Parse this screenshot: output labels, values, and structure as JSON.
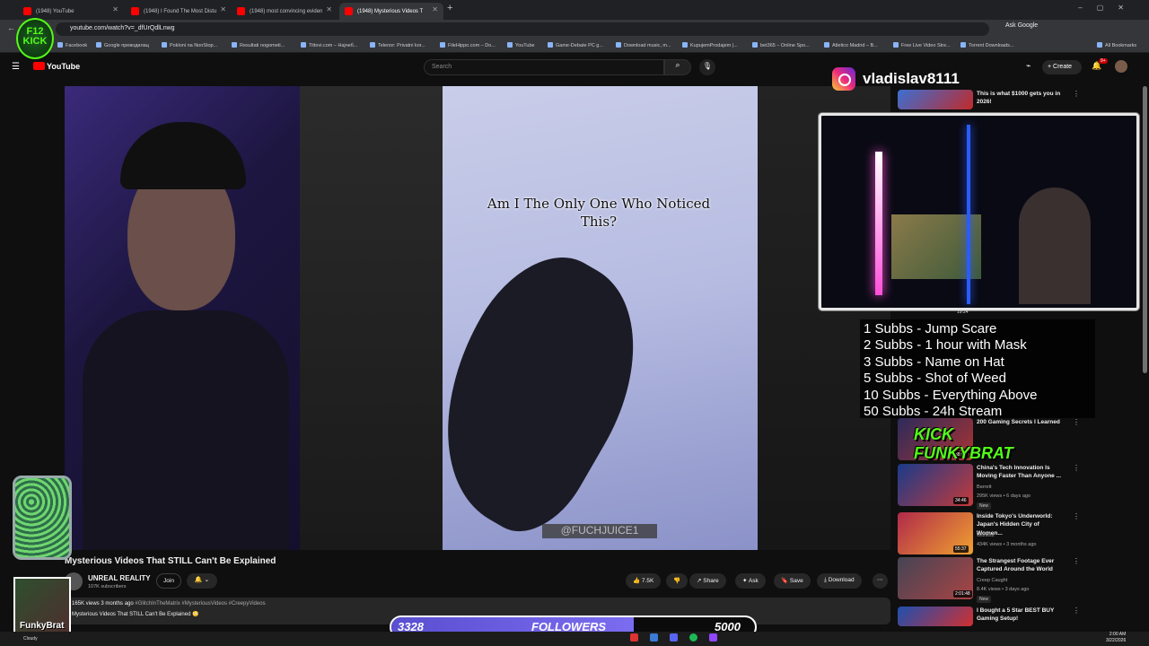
{
  "browser": {
    "tabs": [
      {
        "label": "(1948) YouTube",
        "active": false
      },
      {
        "label": "(1948) I Found The Most Distu",
        "active": false
      },
      {
        "label": "(1948) most convincing eviden",
        "active": false
      },
      {
        "label": "(1948) Mysterious Videos T",
        "active": true
      }
    ],
    "url": "youtube.com/watch?v=_dfUrQdlLnwg",
    "ask_google": "Ask Google",
    "bookmarks": [
      "Facebook",
      "Google преводилац",
      "Pokloni na NonStop...",
      "Resultati nogometi...",
      "Tittovi.com – Најчеб...",
      "Telenor: Privatni kor...",
      "FileHippo.com – Do...",
      "YouTube",
      "Game-Debate PC g...",
      "Download music, m...",
      "KupujemProdajem |...",
      "bet365 – Online Spo...",
      "Atletico Madrid – B...",
      "Free Live Video Stre...",
      "Torrent Downloads..."
    ],
    "all_bookmarks": "All Bookmarks"
  },
  "youtube": {
    "logo": "YouTube",
    "search_placeholder": "Search",
    "create_label": "Create",
    "notifications": "9+"
  },
  "video": {
    "overlay_text": "Am I The Only One Who Noticed This?",
    "watermark": "@FUCHJUICE1",
    "title": "Mysterious Videos That STILL Can't Be Explained",
    "channel": "UNREAL REALITY",
    "subscribers": "107K subscribers",
    "join_label": "Join",
    "likes": "7.5K",
    "share_label": "Share",
    "ask_label": "Ask",
    "save_label": "Save",
    "download_label": "Download",
    "views_line": "165K views  3 months ago",
    "hashtags": "#GlitchInTheMatrix #MysteriousVideos #CreepyVideos",
    "desc_line": "Mysterious Videos That STILL Can't Be Explained 😳"
  },
  "recommendations": [
    {
      "title": "This is what $1000 gets you in 2026!",
      "channel": "",
      "stats": "",
      "duration": "",
      "badge": ""
    },
    {
      "title": "200 Gaming Secrets I Learned",
      "channel": "",
      "stats": "",
      "duration": "38:09",
      "badge": ""
    },
    {
      "title": "China's Tech Innovation Is Moving Faster Than Anyone ...",
      "channel": "Barrett",
      "stats": "295K views • 6 days ago",
      "duration": "34:46",
      "badge": "New"
    },
    {
      "title": "Inside Tokyo's Underworld: Japan's Hidden City of Women...",
      "channel": "Witness",
      "stats": "434K views • 3 months ago",
      "duration": "55:37",
      "badge": ""
    },
    {
      "title": "The Strangest Footage Ever Captured Around the World",
      "channel": "Creep Caught",
      "stats": "8.4K views • 3 days ago",
      "duration": "2:01:48",
      "badge": "New"
    },
    {
      "title": "I Bought a 5 Star BEST BUY Gaming Setup!",
      "channel": "",
      "stats": "",
      "duration": "",
      "badge": ""
    }
  ],
  "stream": {
    "instagram_handle": "vladislav8111",
    "webcam_time": "19:24",
    "sub_goals": [
      "1 Subbs - Jump Scare",
      "2 Subbs - 1 hour with Mask",
      "3 Subbs - Name on Hat",
      "5 Subbs - Shot of Weed",
      "10 Subbs - Everything Above",
      "50 Subbs - 24h Stream"
    ],
    "kick_banner": "KICK FUNKYBRAT",
    "f12_logo": "F12 KICK",
    "avatar_name": "FunkyBrat",
    "followers_current": "3328",
    "followers_label": "FOLLOWERS",
    "followers_goal": "5000",
    "followers_progress": 0.666
  },
  "taskbar": {
    "weather": "Cloudy",
    "time": "2:00 AM",
    "date": "3/22/2026"
  },
  "colors": {
    "youtube_red": "#ff0000",
    "kick_green": "#53fc18",
    "followers_fill": "#6b5ee0"
  }
}
